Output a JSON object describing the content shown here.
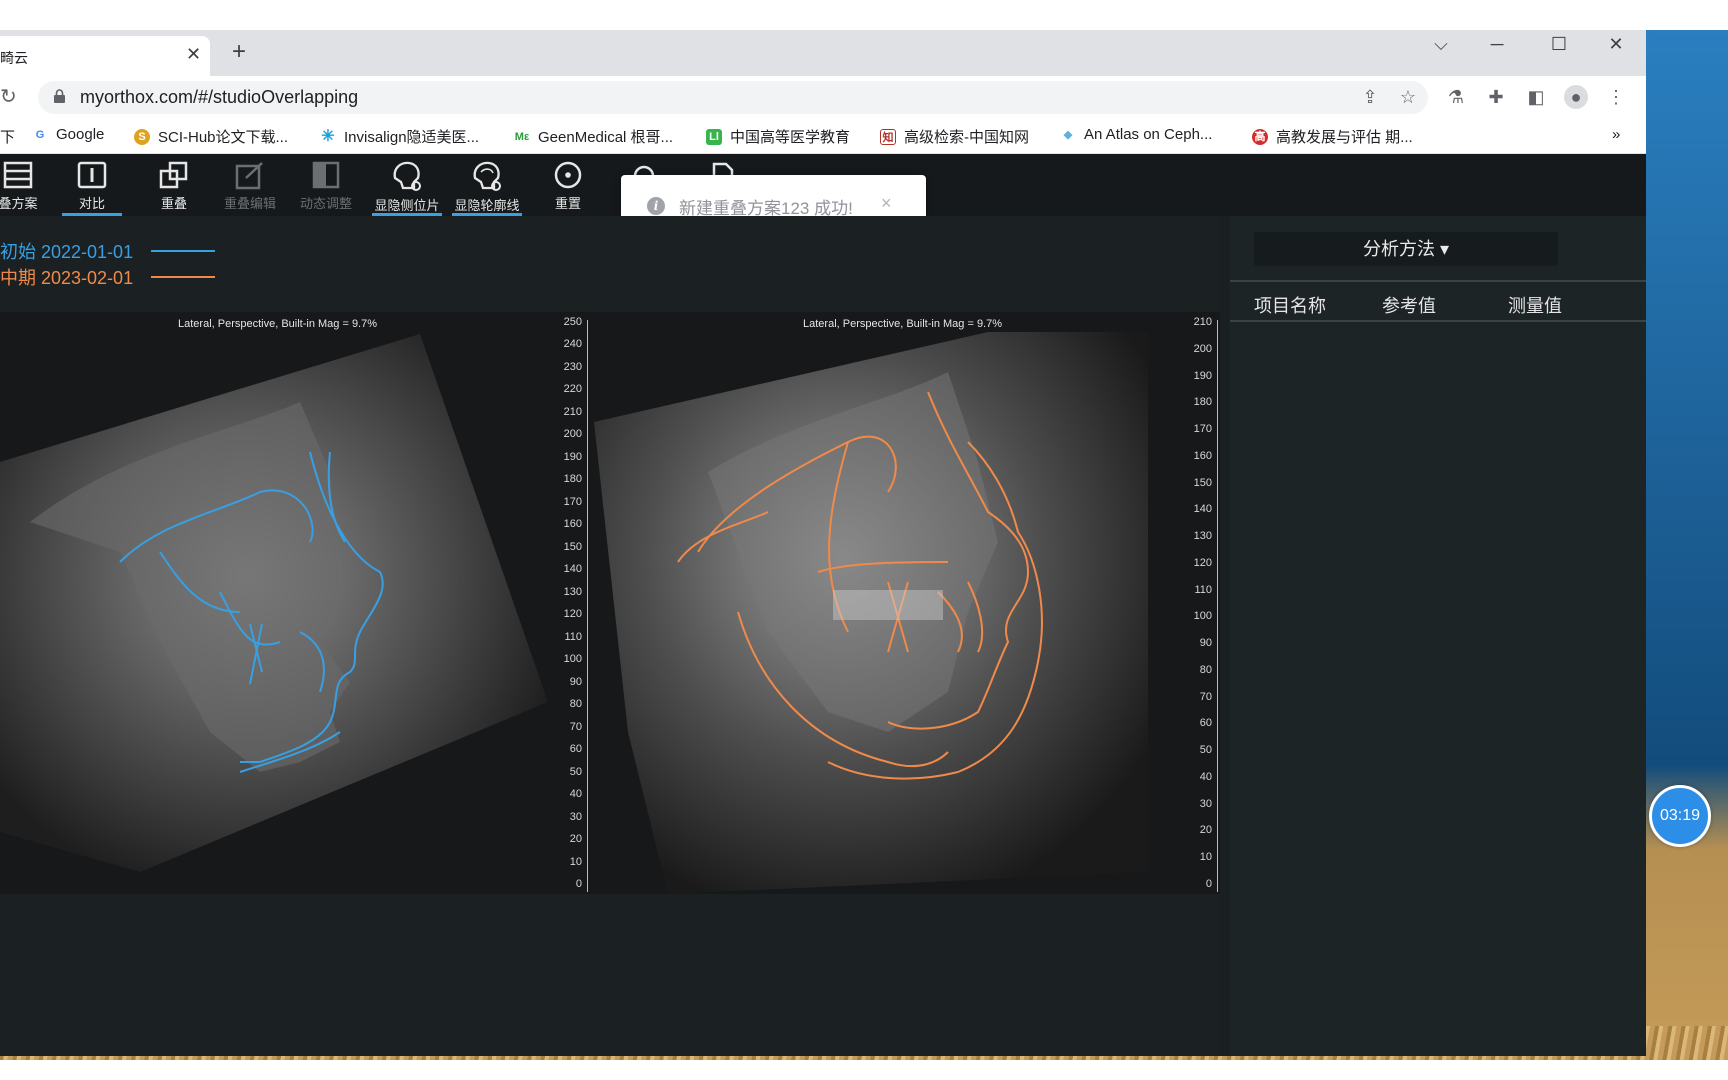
{
  "browser": {
    "tab_title": "畸云",
    "url": "myorthox.com/#/studioOverlapping",
    "bookmarks_prefix": "下",
    "bookmarks": [
      {
        "label": "Google",
        "icon": "google-icon",
        "color": "#4285f4"
      },
      {
        "label": "SCI-Hub论文下载...",
        "icon": "scihub-icon",
        "color": "#e0a020"
      },
      {
        "label": "Invisalign隐适美医...",
        "icon": "invisalign-icon",
        "color": "#1ba0d8"
      },
      {
        "label": "GeenMedical 根哥...",
        "icon": "geenmedical-icon",
        "color": "#2e9a3e"
      },
      {
        "label": "中国高等医学教育",
        "icon": "medical-edu-icon",
        "color": "#35b54a"
      },
      {
        "label": "高级检索-中国知网",
        "icon": "cnki-icon",
        "color": "#b0322a"
      },
      {
        "label": "An Atlas on Ceph...",
        "icon": "atlas-icon",
        "color": "#5fb0e0"
      },
      {
        "label": "高教发展与评估 期...",
        "icon": "journal-icon",
        "color": "#d62b2b"
      }
    ],
    "more_bookmarks": "»"
  },
  "toolbar": {
    "items": [
      {
        "label": "叠方案",
        "icon": "list-icon",
        "disabled": false,
        "active": false
      },
      {
        "label": "对比",
        "icon": "compare-icon",
        "disabled": false,
        "active": true
      },
      {
        "label": "重叠",
        "icon": "overlap-icon",
        "disabled": false,
        "active": false
      },
      {
        "label": "重叠编辑",
        "icon": "edit-icon",
        "disabled": true,
        "active": false
      },
      {
        "label": "动态调整",
        "icon": "adjust-icon",
        "disabled": true,
        "active": false
      },
      {
        "label": "显隐侧位片",
        "icon": "toggle-xray-icon",
        "disabled": false,
        "active": true
      },
      {
        "label": "显隐轮廓线",
        "icon": "toggle-outline-icon",
        "disabled": false,
        "active": true
      },
      {
        "label": "重置",
        "icon": "reset-icon",
        "disabled": false,
        "active": false
      }
    ]
  },
  "toast": {
    "message": "新建重叠方案123 成功!",
    "close": "×"
  },
  "legend": [
    {
      "label": "初始 2022-01-01",
      "color": "#3a9fe0"
    },
    {
      "label": "中期 2023-02-01",
      "color": "#f08a4b"
    }
  ],
  "images": [
    {
      "caption": "Lateral, Perspective, Built-in Mag = 9.7%",
      "ruler_ticks": [
        "250",
        "240",
        "230",
        "220",
        "210",
        "200",
        "190",
        "180",
        "170",
        "160",
        "150",
        "140",
        "130",
        "120",
        "110",
        "100",
        "90",
        "80",
        "70",
        "60",
        "50",
        "40",
        "30",
        "20",
        "10",
        "0"
      ]
    },
    {
      "caption": "Lateral, Perspective, Built-in Mag = 9.7%",
      "ruler_ticks": [
        "210",
        "200",
        "190",
        "180",
        "170",
        "160",
        "150",
        "140",
        "130",
        "120",
        "110",
        "100",
        "90",
        "80",
        "70",
        "60",
        "50",
        "40",
        "30",
        "20",
        "10",
        "0"
      ]
    }
  ],
  "panel": {
    "analysis_button": "分析方法 ▾",
    "columns": [
      "项目名称",
      "参考值",
      "测量值"
    ]
  },
  "timer": "03:19"
}
